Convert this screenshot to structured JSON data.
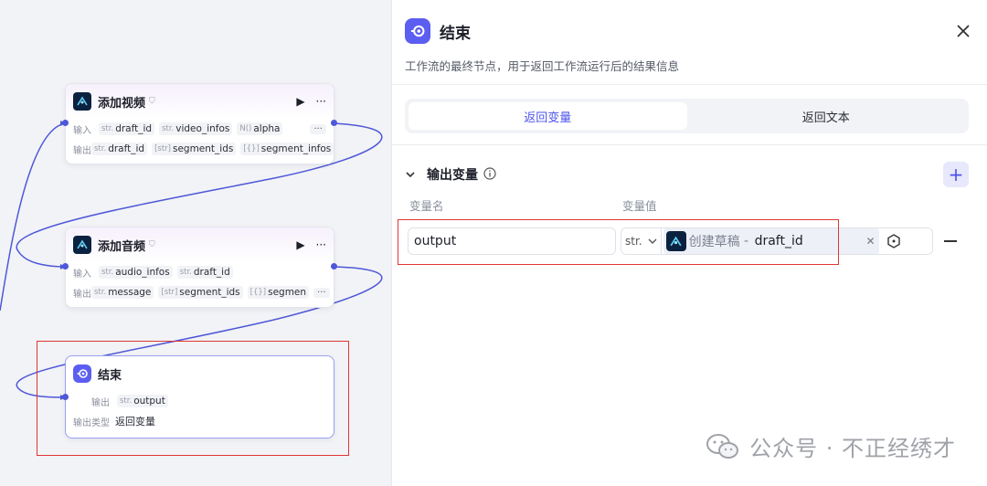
{
  "canvas": {
    "nodes": {
      "add_video": {
        "title": "添加视频",
        "input_label": "输入",
        "output_label": "输出",
        "inputs": [
          {
            "type": "str.",
            "name": "draft_id"
          },
          {
            "type": "str.",
            "name": "video_infos"
          },
          {
            "type": "N()",
            "name": "alpha"
          }
        ],
        "outputs": [
          {
            "type": "str.",
            "name": "draft_id"
          },
          {
            "type": "[str]",
            "name": "segment_ids"
          },
          {
            "type": "[{}]",
            "name": "segment_infos"
          }
        ],
        "more": "···"
      },
      "add_audio": {
        "title": "添加音频",
        "input_label": "输入",
        "output_label": "输出",
        "inputs": [
          {
            "type": "str.",
            "name": "audio_infos"
          },
          {
            "type": "str.",
            "name": "draft_id"
          }
        ],
        "outputs": [
          {
            "type": "str.",
            "name": "message"
          },
          {
            "type": "[str]",
            "name": "segment_ids"
          },
          {
            "type": "[{}]",
            "name": "segmen"
          }
        ],
        "more": "···"
      },
      "end": {
        "title": "结束",
        "output_label": "输出",
        "output": {
          "type": "str.",
          "name": "output"
        },
        "output_type_label": "输出类型",
        "output_type_value": "返回变量"
      }
    },
    "edge_color": "#4e58d8",
    "highlight_color": "#e03535"
  },
  "panel": {
    "title": "结束",
    "description": "工作流的最终节点，用于返回工作流运行后的结果信息",
    "tabs": [
      {
        "label": "返回变量",
        "active": true
      },
      {
        "label": "返回文本",
        "active": false
      }
    ],
    "section_title": "输出变量",
    "col_name": "变量名",
    "col_value": "变量值",
    "variable": {
      "name": "output",
      "type": "str.",
      "ref_node": "创建草稿",
      "ref_sep": " - ",
      "ref_var": "draft_id"
    },
    "accent": "#4d53e8"
  },
  "watermark": "公众号 · 不正经绣才"
}
